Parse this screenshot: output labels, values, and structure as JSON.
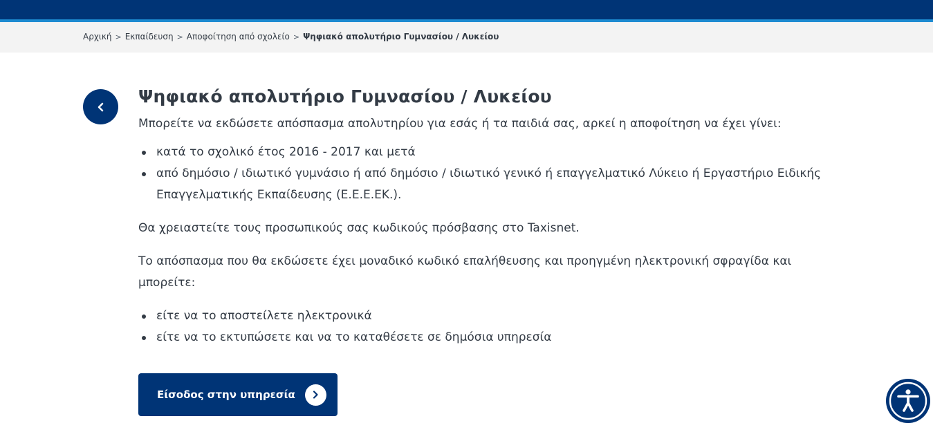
{
  "breadcrumb": {
    "items": [
      "Αρχική",
      "Εκπαίδευση",
      "Αποφοίτηση από σχολείο"
    ],
    "separator": ">",
    "current": "Ψηφιακό απολυτήριο Γυμνασίου / Λυκείου"
  },
  "page": {
    "title": "Ψηφιακό απολυτήριο Γυμνασίου / Λυκείου",
    "intro": "Μπορείτε να εκδώσετε απόσπασμα απολυτηρίου για εσάς ή τα παιδιά σας, αρκεί η αποφοίτηση να έχει γίνει:",
    "conditions": [
      "κατά το σχολικό έτος 2016 - 2017 και μετά",
      "από δημόσιο / ιδιωτικό γυμνάσιο ή από δημόσιο / ιδιωτικό γενικό ή επαγγελματικό Λύκειο ή Εργαστήριο Ειδικής Επαγγελματικής Εκπαίδευσης (Ε.Ε.Ε.ΕΚ.)."
    ],
    "taxisnet_note": "Θα χρειαστείτε τους προσωπικούς σας κωδικούς πρόσβασης στο Taxisnet.",
    "seal_note": "Το απόσπασμα που θα εκδώσετε έχει μοναδικό κωδικό επαλήθευσης και προηγμένη ηλεκτρονική σφραγίδα και μπορείτε:",
    "options": [
      "είτε να το αποστείλετε ηλεκτρονικά",
      "είτε να το εκτυπώσετε και να το καταθέσετε σε δημόσια υπηρεσία"
    ]
  },
  "cta": {
    "label": "Είσοδος στην υπηρεσία",
    "icon": "chevron-right-icon"
  },
  "icons": {
    "back": "chevron-left-icon",
    "accessibility": "accessibility-icon"
  },
  "colors": {
    "brand": "#003476",
    "accent": "#1d8bd1",
    "text": "#333b45",
    "breadcrumb_bg": "#f3f3f3"
  }
}
